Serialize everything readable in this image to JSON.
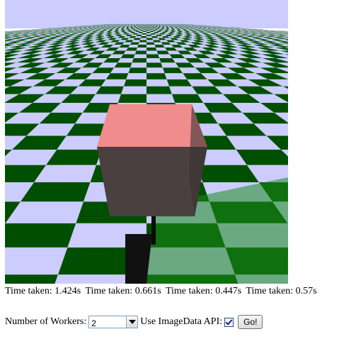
{
  "scene": {
    "sky_color": "#ccccff",
    "floor_dark_color": "#004f00",
    "floor_light_color": "#ccccff",
    "cube_top_color": "#f08c8c",
    "cube_side_color": "#4a4040"
  },
  "timings": [
    "Time taken: 1.424s",
    "Time taken: 0.661s",
    "Time taken: 0.447s",
    "Time taken: 0.57s"
  ],
  "controls": {
    "workers_label": "Number of Workers:",
    "workers_value": "2",
    "imagedata_label": "Use ImageData API:",
    "imagedata_checked": true,
    "go_label": "Go!"
  }
}
